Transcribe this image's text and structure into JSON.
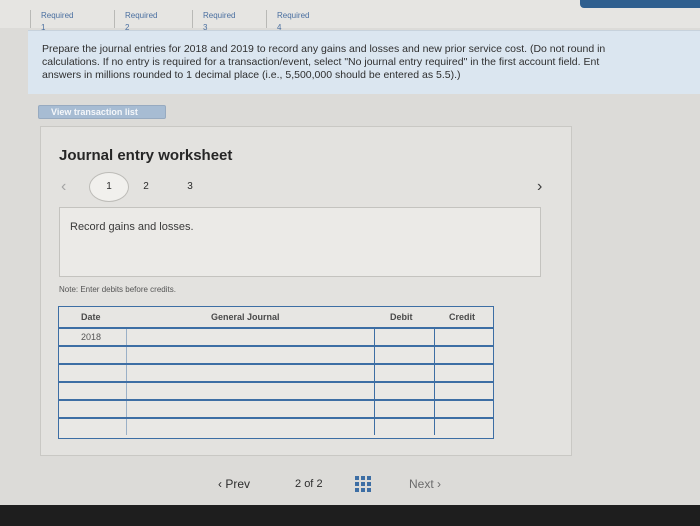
{
  "header": {
    "requirement_tabs": [
      "Required 1",
      "Required 2",
      "Required 3",
      "Required 4"
    ]
  },
  "instructions": {
    "line1": "Prepare the journal entries for 2018 and 2019 to record any gains and losses and new prior service cost. (Do not round in",
    "line2": "calculations. If no entry is required for a transaction/event, select \"No journal entry required\" in the first account field. Ent",
    "line3": "answers in millions rounded to 1 decimal place (i.e., 5,500,000 should be entered as 5.5).)"
  },
  "view_transaction_list": "View transaction list",
  "worksheet": {
    "title": "Journal entry worksheet",
    "steps": [
      "1",
      "2",
      "3"
    ],
    "prompt": "Record gains and losses.",
    "note": "Note: Enter debits before credits.",
    "table": {
      "headers": {
        "date": "Date",
        "account": "General Journal",
        "debit": "Debit",
        "credit": "Credit"
      },
      "rows": [
        {
          "date": "2018",
          "account": "",
          "debit": "",
          "credit": ""
        },
        {
          "date": "",
          "account": "",
          "debit": "",
          "credit": ""
        },
        {
          "date": "",
          "account": "",
          "debit": "",
          "credit": ""
        },
        {
          "date": "",
          "account": "",
          "debit": "",
          "credit": ""
        },
        {
          "date": "",
          "account": "",
          "debit": "",
          "credit": ""
        },
        {
          "date": "",
          "account": "",
          "debit": "",
          "credit": ""
        }
      ]
    }
  },
  "pagination": {
    "prev": "Prev",
    "current": "2",
    "of": "of",
    "total": "2",
    "next": "Next"
  },
  "icons": {
    "left": "chevron-left-icon",
    "right": "chevron-right-icon",
    "grid": "grid-icon"
  }
}
